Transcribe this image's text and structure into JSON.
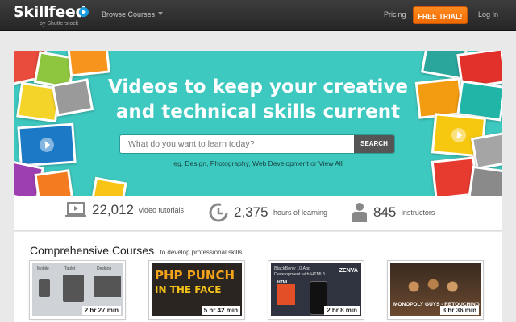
{
  "header": {
    "logo_text": "Skillfeed",
    "logo_sub": "by Shutterstock",
    "browse_label": "Browse Courses",
    "pricing_label": "Pricing",
    "trial_label": "FREE TRIAL!",
    "login_label": "Log In"
  },
  "hero": {
    "headline_line1": "Videos to keep your creative",
    "headline_line2": "and technical skills current",
    "search_placeholder": "What do you want to learn today?",
    "search_button": "SEARCH",
    "examples_prefix": "eg.",
    "examples": [
      "Design",
      "Photography",
      "Web Development"
    ],
    "examples_or": "or",
    "view_all": "View All"
  },
  "stats": [
    {
      "number": "22,012",
      "label": "video tutorials",
      "icon": "laptop-icon"
    },
    {
      "number": "2,375",
      "label": "hours of learning",
      "icon": "clock-icon"
    },
    {
      "number": "845",
      "label": "instructors",
      "icon": "instructor-icon"
    }
  ],
  "courses": {
    "title": "Comprehensive Courses",
    "subtitle": "to develop professional skills",
    "items": [
      {
        "duration": "2 hr 27 min",
        "thumb_text": [
          "Mobile",
          "Tablet",
          "Desktop"
        ]
      },
      {
        "duration": "5 hr 42 min",
        "thumb_text": [
          "PHP PUNCH",
          "IN THE FACE"
        ]
      },
      {
        "duration": "2 hr 8 min",
        "thumb_text": [
          "BlackBerry 10 App",
          "Development with HTML5",
          "ZENVA",
          "HTML"
        ]
      },
      {
        "duration": "3 hr 36 min",
        "thumb_text": [
          "MONOPOLY GUYS - RETOUCHING"
        ]
      }
    ]
  },
  "colors": {
    "hero_bg": "#3ec9c0",
    "trial_orange": "#f57a0c",
    "header_dark": "#2e2e2e"
  }
}
